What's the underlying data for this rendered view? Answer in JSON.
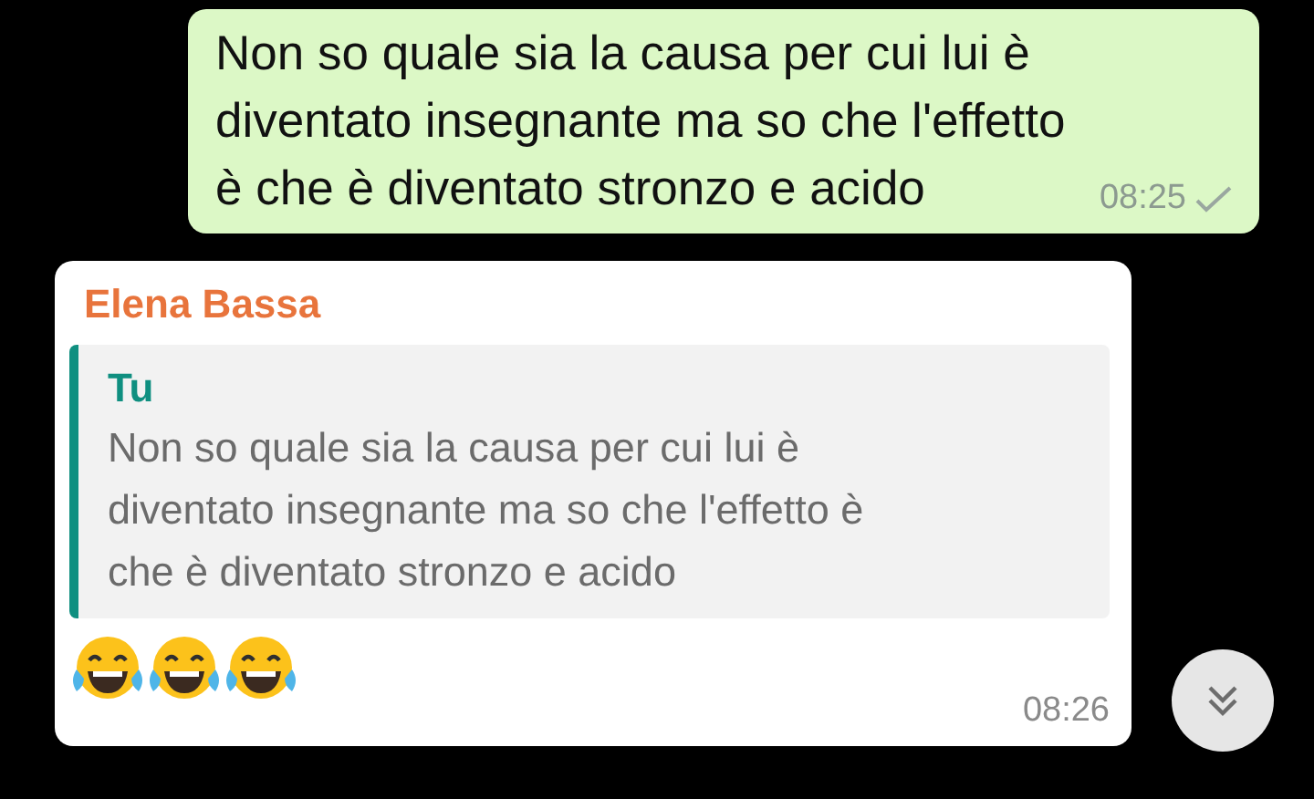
{
  "outgoing": {
    "text": "Non so quale sia la causa per cui lui è diventato insegnante ma so che l'effetto è che è diventato stronzo e acido",
    "time": "08:25",
    "delivered": false,
    "read": false
  },
  "incoming": {
    "sender": "Elena Bassa",
    "quote": {
      "author": "Tu",
      "text": "Non so quale sia la causa per cui lui è diventato insegnante ma so che l'effetto è che è diventato stronzo e acido"
    },
    "emojis": [
      {
        "kind": "tears-of-joy"
      },
      {
        "kind": "tears-of-joy"
      },
      {
        "kind": "tears-of-joy"
      }
    ],
    "time": "08:26"
  },
  "scroll_button": {
    "kind": "double-chevron-down"
  }
}
